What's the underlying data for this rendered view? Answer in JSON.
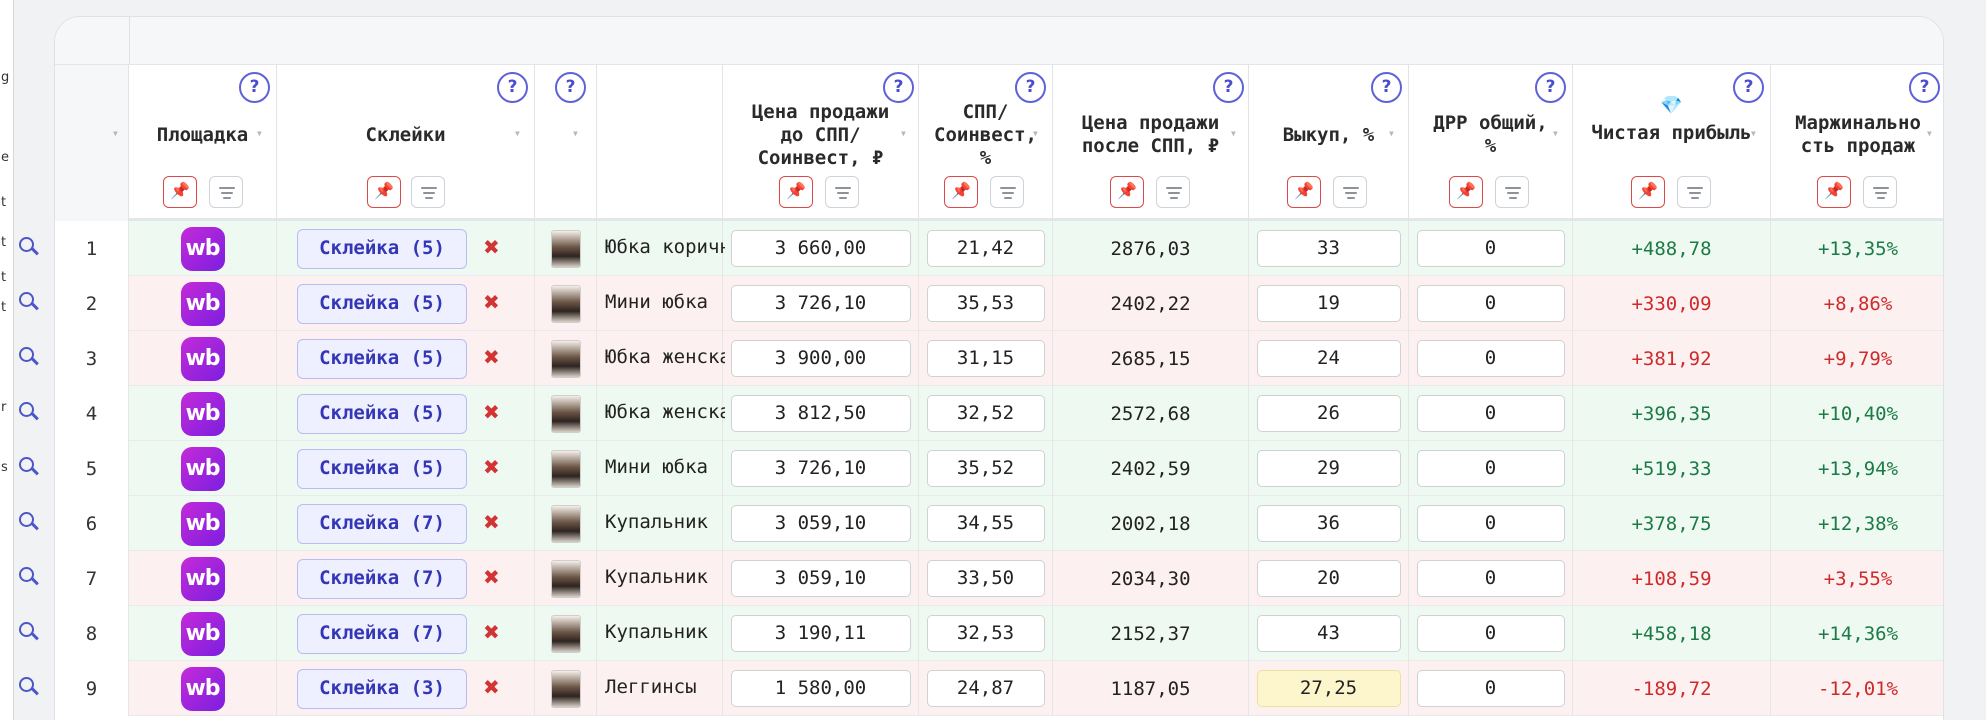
{
  "headers": {
    "platform": "Площадка",
    "glues": "Склейки",
    "price_before": "Цена продажи\nдо СПП/\nСоинвест, ₽",
    "spp": "СПП/\nСоинвест,\n%",
    "price_after": "Цена продажи\nпосле СПП, ₽",
    "buyout": "Выкуп, %",
    "drr": "ДРР общий,\n%",
    "profit": "Чистая прибыль",
    "margin": "Маржинально\nсть продаж",
    "help": "?",
    "profit_gem": "💎"
  },
  "left_strip": [
    "g",
    "e",
    "t",
    "t",
    "t",
    "t",
    "r",
    "s"
  ],
  "platform_logo": "wb",
  "delete_glyph": "✖",
  "rows": [
    {
      "n": "1",
      "glue": "Склейка (5)",
      "name": "Юбка коричневая",
      "price_before": "3 660,00",
      "spp": "21,42",
      "price_after": "2876,03",
      "buyout": "33",
      "drr": "0",
      "profit": "+488,78",
      "margin": "+13,35%",
      "state": "green"
    },
    {
      "n": "2",
      "glue": "Склейка (5)",
      "name": "Мини юбка",
      "price_before": "3 726,10",
      "spp": "35,53",
      "price_after": "2402,22",
      "buyout": "19",
      "drr": "0",
      "profit": "+330,09",
      "margin": "+8,86%",
      "state": "red"
    },
    {
      "n": "3",
      "glue": "Склейка (5)",
      "name": "Юбка женская",
      "price_before": "3 900,00",
      "spp": "31,15",
      "price_after": "2685,15",
      "buyout": "24",
      "drr": "0",
      "profit": "+381,92",
      "margin": "+9,79%",
      "state": "red"
    },
    {
      "n": "4",
      "glue": "Склейка (5)",
      "name": "Юбка женская",
      "price_before": "3 812,50",
      "spp": "32,52",
      "price_after": "2572,68",
      "buyout": "26",
      "drr": "0",
      "profit": "+396,35",
      "margin": "+10,40%",
      "state": "green"
    },
    {
      "n": "5",
      "glue": "Склейка (5)",
      "name": "Мини юбка",
      "price_before": "3 726,10",
      "spp": "35,52",
      "price_after": "2402,59",
      "buyout": "29",
      "drr": "0",
      "profit": "+519,33",
      "margin": "+13,94%",
      "state": "green"
    },
    {
      "n": "6",
      "glue": "Склейка (7)",
      "name": "Купальник",
      "price_before": "3 059,10",
      "spp": "34,55",
      "price_after": "2002,18",
      "buyout": "36",
      "drr": "0",
      "profit": "+378,75",
      "margin": "+12,38%",
      "state": "green"
    },
    {
      "n": "7",
      "glue": "Склейка (7)",
      "name": "Купальник",
      "price_before": "3 059,10",
      "spp": "33,50",
      "price_after": "2034,30",
      "buyout": "20",
      "drr": "0",
      "profit": "+108,59",
      "margin": "+3,55%",
      "state": "red"
    },
    {
      "n": "8",
      "glue": "Склейка (7)",
      "name": "Купальник",
      "price_before": "3 190,11",
      "spp": "32,53",
      "price_after": "2152,37",
      "buyout": "43",
      "drr": "0",
      "profit": "+458,18",
      "margin": "+14,36%",
      "state": "green"
    },
    {
      "n": "9",
      "glue": "Склейка (3)",
      "name": "Леггинсы",
      "price_before": "1 580,00",
      "spp": "24,87",
      "price_after": "1187,05",
      "buyout": "27,25",
      "drr": "0",
      "profit": "-189,72",
      "margin": "-12,01%",
      "state": "red",
      "buyout_warn": true
    }
  ],
  "colors": {
    "positive": "#1c7a45",
    "negative": "#cf2a2a",
    "accent": "#4b4dd0",
    "row_green": "#eef9f2",
    "row_red": "#fdf0f0"
  }
}
